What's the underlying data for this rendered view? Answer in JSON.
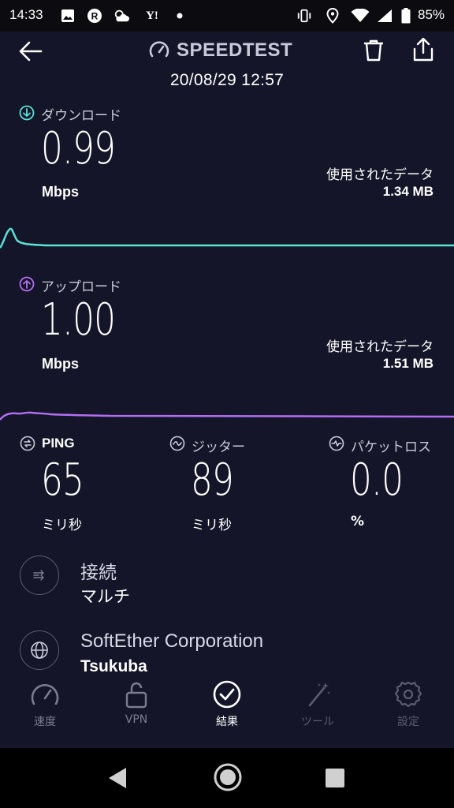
{
  "status_bar": {
    "time": "14:33",
    "battery": "85%",
    "icons": [
      "image-icon",
      "r-app-icon",
      "weather-icon",
      "yahoo-icon",
      "dot-icon",
      "vibrate-icon",
      "location-icon",
      "wifi-icon",
      "signal-icon",
      "battery-icon"
    ],
    "yahoo_text": "Y!"
  },
  "header": {
    "title": "SPEEDTEST",
    "date": "20/08/29 12:57"
  },
  "download": {
    "label": "ダウンロード",
    "value": "0.99",
    "unit": "Mbps",
    "data_label": "使用されたデータ",
    "data_value": "1.34 MB",
    "color": "#5ce1d6"
  },
  "upload": {
    "label": "アップロード",
    "value": "1.00",
    "unit": "Mbps",
    "data_label": "使用されたデータ",
    "data_value": "1.51 MB",
    "color": "#b26ef2"
  },
  "metrics": {
    "ping": {
      "label": "PING",
      "value": "65",
      "unit": "ミリ秒"
    },
    "jitter": {
      "label": "ジッター",
      "value": "89",
      "unit": "ミリ秒"
    },
    "loss": {
      "label": "パケットロス",
      "value": "0.0",
      "unit": "%"
    }
  },
  "connection": {
    "title": "接続",
    "value": "マルチ"
  },
  "server": {
    "title": "SoftEther Corporation",
    "location": "Tsukuba"
  },
  "nav": {
    "speed": "速度",
    "vpn": "VPN",
    "results": "結果",
    "tools": "ツール",
    "settings": "設定"
  }
}
